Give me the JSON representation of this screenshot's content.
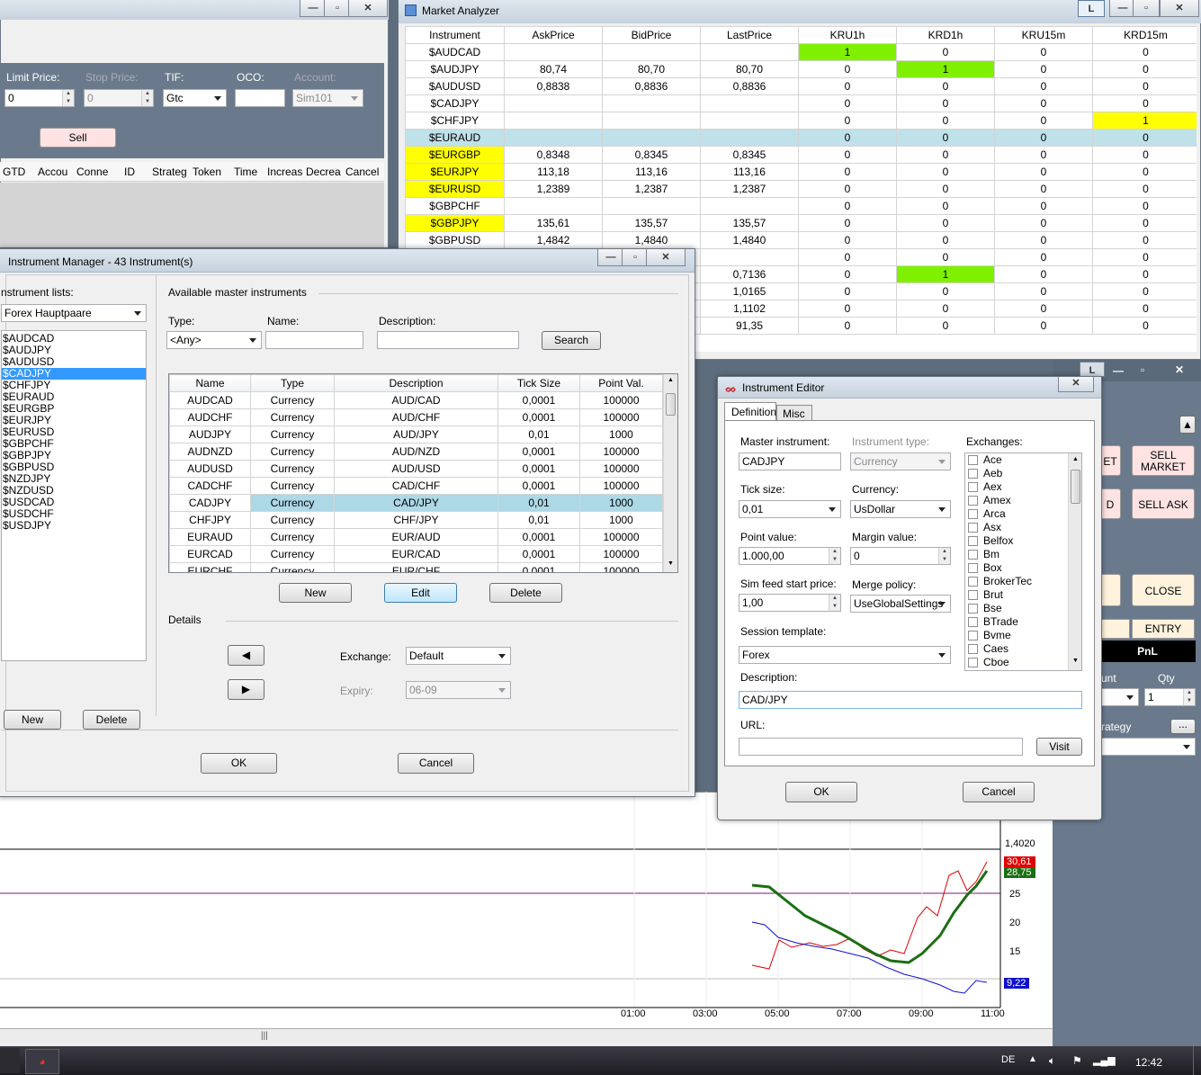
{
  "order_window": {
    "limit_price_label": "Limit Price:",
    "stop_price_label": "Stop Price:",
    "tif_label": "TIF:",
    "oco_label": "OCO:",
    "account_label": "Account:",
    "limit_price_value": "0",
    "stop_price_value": "0",
    "tif_value": "Gtc",
    "account_value": "Sim101",
    "sell_label": "Sell",
    "columns": [
      "GTD",
      "Accou",
      "Conne",
      "ID",
      "Strateg",
      "Token",
      "Time",
      "Increas",
      "Decrea",
      "Cancel"
    ]
  },
  "market_analyzer": {
    "title": "Market Analyzer",
    "l_button": "L",
    "columns": [
      "Instrument",
      "AskPrice",
      "BidPrice",
      "LastPrice",
      "KRU1h",
      "KRD1h",
      "KRU15m",
      "KRD15m"
    ],
    "rows": [
      [
        "$AUDCAD",
        "",
        "",
        "",
        "1",
        "0",
        "0",
        "0"
      ],
      [
        "$AUDJPY",
        "80,74",
        "80,70",
        "80,70",
        "0",
        "1",
        "0",
        "0"
      ],
      [
        "$AUDUSD",
        "0,8838",
        "0,8836",
        "0,8836",
        "0",
        "0",
        "0",
        "0"
      ],
      [
        "$CADJPY",
        "",
        "",
        "",
        "0",
        "0",
        "0",
        "0"
      ],
      [
        "$CHFJPY",
        "",
        "",
        "",
        "0",
        "0",
        "0",
        "1"
      ],
      [
        "$EURAUD",
        "",
        "",
        "",
        "0",
        "0",
        "0",
        "0"
      ],
      [
        "$EURGBP",
        "0,8348",
        "0,8345",
        "0,8345",
        "0",
        "0",
        "0",
        "0"
      ],
      [
        "$EURJPY",
        "113,18",
        "113,16",
        "113,16",
        "0",
        "0",
        "0",
        "0"
      ],
      [
        "$EURUSD",
        "1,2389",
        "1,2387",
        "1,2387",
        "0",
        "0",
        "0",
        "0"
      ],
      [
        "$GBPCHF",
        "",
        "",
        "",
        "0",
        "0",
        "0",
        "0"
      ],
      [
        "$GBPJPY",
        "135,61",
        "135,57",
        "135,57",
        "0",
        "0",
        "0",
        "0"
      ],
      [
        "$GBPUSD",
        "1,4842",
        "1,4840",
        "1,4840",
        "0",
        "0",
        "0",
        "0"
      ],
      [
        "",
        "",
        "",
        "",
        "0",
        "0",
        "0",
        "0"
      ],
      [
        "",
        "",
        "",
        "0,7136",
        "0",
        "1",
        "0",
        "0"
      ],
      [
        "",
        "",
        "",
        "1,0165",
        "0",
        "0",
        "0",
        "0"
      ],
      [
        "",
        "",
        "",
        "1,1102",
        "0",
        "0",
        "0",
        "0"
      ],
      [
        "",
        "",
        "",
        "91,35",
        "0",
        "0",
        "0",
        "0"
      ]
    ]
  },
  "instrument_manager": {
    "title": "Instrument Manager - 43 Instrument(s)",
    "lists_label": "nstrument lists:",
    "list_value": "Forex Hauptpaare",
    "list_items": [
      "$AUDCAD",
      "$AUDJPY",
      "$AUDUSD",
      "$CADJPY",
      "$CHFJPY",
      "$EURAUD",
      "$EURGBP",
      "$EURJPY",
      "$EURUSD",
      "$GBPCHF",
      "$GBPJPY",
      "$GBPUSD",
      "$NZDJPY",
      "$NZDUSD",
      "$USDCAD",
      "$USDCHF",
      "$USDJPY"
    ],
    "new_label": "New",
    "delete_label": "Delete",
    "available_label": "Available master instruments",
    "type_label": "Type:",
    "name_label": "Name:",
    "description_label": "Description:",
    "type_value": "<Any>",
    "search_label": "Search",
    "grid_columns": [
      "Name",
      "Type",
      "Description",
      "Tick Size",
      "Point Val."
    ],
    "grid_rows": [
      [
        "AUDCAD",
        "Currency",
        "AUD/CAD",
        "0,0001",
        "100000"
      ],
      [
        "AUDCHF",
        "Currency",
        "AUD/CHF",
        "0,0001",
        "100000"
      ],
      [
        "AUDJPY",
        "Currency",
        "AUD/JPY",
        "0,01",
        "1000"
      ],
      [
        "AUDNZD",
        "Currency",
        "AUD/NZD",
        "0,0001",
        "100000"
      ],
      [
        "AUDUSD",
        "Currency",
        "AUD/USD",
        "0,0001",
        "100000"
      ],
      [
        "CADCHF",
        "Currency",
        "CAD/CHF",
        "0,0001",
        "100000"
      ],
      [
        "CADJPY",
        "Currency",
        "CAD/JPY",
        "0,01",
        "1000"
      ],
      [
        "CHFJPY",
        "Currency",
        "CHF/JPY",
        "0,01",
        "1000"
      ],
      [
        "EURAUD",
        "Currency",
        "EUR/AUD",
        "0,0001",
        "100000"
      ],
      [
        "EURCAD",
        "Currency",
        "EUR/CAD",
        "0,0001",
        "100000"
      ],
      [
        "EURCHF",
        "Currency",
        "EUR/CHF",
        "0,0001",
        "100000"
      ]
    ],
    "grid_new": "New",
    "grid_edit": "Edit",
    "grid_delete": "Delete",
    "details_label": "Details",
    "exchange_label": "Exchange:",
    "exchange_value": "Default",
    "expiry_label": "Expiry:",
    "expiry_value": "06-09",
    "ok_label": "OK",
    "cancel_label": "Cancel"
  },
  "instrument_editor": {
    "title": "Instrument Editor",
    "tabs": [
      "Definition",
      "Misc"
    ],
    "master_label": "Master instrument:",
    "master_value": "CADJPY",
    "type_label": "Instrument type:",
    "type_value": "Currency",
    "exchanges_label": "Exchanges:",
    "exchanges": [
      "Ace",
      "Aeb",
      "Aex",
      "Amex",
      "Arca",
      "Asx",
      "Belfox",
      "Bm",
      "Box",
      "BrokerTec",
      "Brut",
      "Bse",
      "BTrade",
      "Bvme",
      "Caes",
      "Cboe"
    ],
    "tick_label": "Tick size:",
    "tick_value": "0,01",
    "currency_label": "Currency:",
    "currency_value": "UsDollar",
    "point_label": "Point value:",
    "point_value": "1.000,00",
    "margin_label": "Margin value:",
    "margin_value": "0",
    "sim_label": "Sim feed start price:",
    "sim_value": "1,00",
    "merge_label": "Merge policy:",
    "merge_value": "UseGlobalSettings",
    "session_label": "Session template:",
    "session_value": "Forex",
    "description_label": "Description:",
    "description_value": "CAD/JPY",
    "url_label": "URL:",
    "visit_label": "Visit",
    "ok_label": "OK",
    "cancel_label": "Cancel"
  },
  "right_panel": {
    "sell_market": "SELL\nMARKET",
    "sell_ask": "SELL ASK",
    "frag_t": "ET",
    "frag_d": "D",
    "close": "CLOSE",
    "entry": "ENTRY",
    "pnl": "PnL",
    "account_frag": "unt",
    "qty_label": "Qty",
    "qty_value": "1",
    "strategy_frag": "rategy",
    "more_label": "...",
    "l_button": "L"
  },
  "chart": {
    "price_label": "1,4020",
    "y_ticks": [
      "25",
      "20",
      "15"
    ],
    "x_ticks": [
      "01:00",
      "03:00",
      "05:00",
      "07:00",
      "09:00",
      "11:00"
    ],
    "badge_red": "30,61",
    "badge_green": "28,75",
    "badge_blue": "9,22",
    "colors": {
      "red": "#e00000",
      "green": "#1a6e12",
      "blue": "#1010d0",
      "purple": "#7a1a7a"
    }
  },
  "taskbar": {
    "lang": "DE",
    "time": "12:42"
  }
}
